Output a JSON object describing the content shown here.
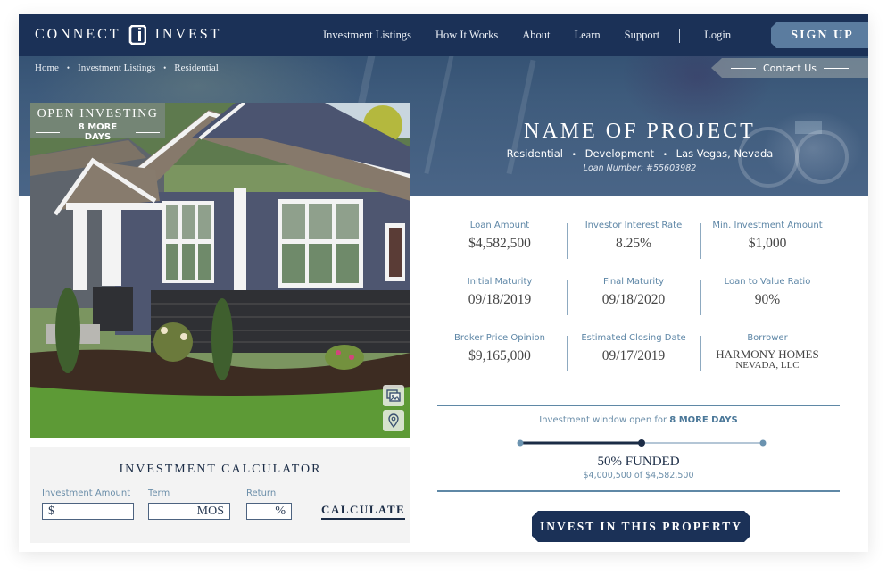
{
  "brand": {
    "left": "CONNECT",
    "right": "INVEST"
  },
  "nav": {
    "links": [
      "Investment Listings",
      "How It Works",
      "About",
      "Learn",
      "Support"
    ],
    "login": "Login",
    "signup": "SIGN UP"
  },
  "breadcrumb": [
    "Home",
    "Investment Listings",
    "Residential"
  ],
  "contact": "Contact Us",
  "badge": {
    "title": "OPEN INVESTING",
    "days": "8 MORE DAYS"
  },
  "photo_buttons": {
    "gallery": "gallery-icon",
    "map": "map-pin-icon"
  },
  "project": {
    "name": "NAME OF PROJECT",
    "tags": [
      "Residential",
      "Development",
      "Las Vegas, Nevada"
    ],
    "loan_number": "Loan Number: #55603982"
  },
  "stats": [
    {
      "label": "Loan Amount",
      "value": "$4,582,500"
    },
    {
      "label": "Investor Interest Rate",
      "value": "8.25%"
    },
    {
      "label": "Min. Investment Amount",
      "value": "$1,000"
    },
    {
      "label": "Initial Maturity",
      "value": "09/18/2019"
    },
    {
      "label": "Final Maturity",
      "value": "09/18/2020"
    },
    {
      "label": "Loan to Value Ratio",
      "value": "90%"
    },
    {
      "label": "Broker Price Opinion",
      "value": "$9,165,000"
    },
    {
      "label": "Estimated Closing Date",
      "value": "09/17/2019"
    },
    {
      "label": "Borrower",
      "value": "HARMONY HOMES",
      "value_line2": "NEVADA, LLC"
    }
  ],
  "funding": {
    "window_prefix": "Investment window open for ",
    "window_days": "8 MORE DAYS",
    "progress": 0.5,
    "funded_label": "50% FUNDED",
    "amount_text": "$4,000,500 of $4,582,500",
    "invest_button": "INVEST IN THIS PROPERTY"
  },
  "calculator": {
    "title": "INVESTMENT CALCULATOR",
    "amount_label": "Investment Amount",
    "amount_prefix": "$",
    "amount_value": "",
    "term_label": "Term",
    "term_suffix": "MOS",
    "term_value": "",
    "return_label": "Return",
    "return_suffix": "%",
    "return_value": "",
    "button": "CALCULATE"
  },
  "colors": {
    "navy": "#1b3157",
    "accent_blue": "#5b7c9f",
    "label_blue": "#5d86a6",
    "divider": "#5f88a6"
  }
}
